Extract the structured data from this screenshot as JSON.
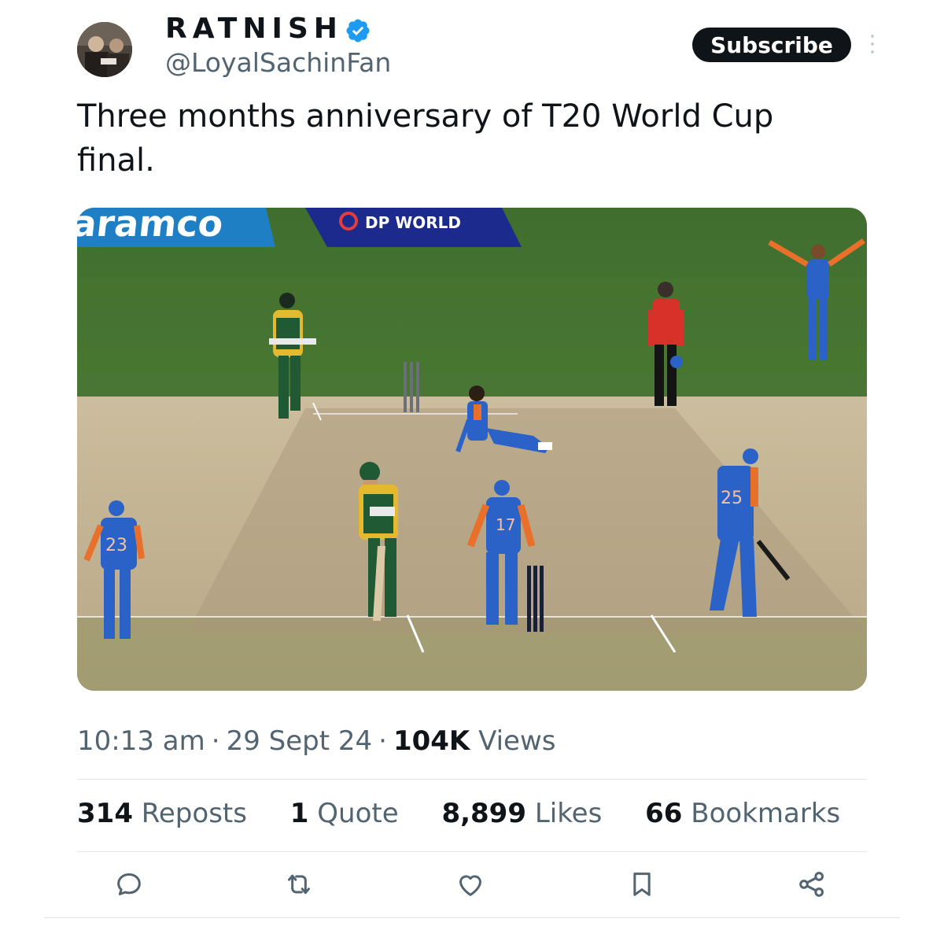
{
  "author": {
    "display_name": "RATNISH",
    "handle": "@LoyalSachinFan",
    "verified_icon": "verified-badge-icon",
    "avatar": "profile-photo"
  },
  "header": {
    "subscribe_label": "Subscribe",
    "more_icon": "more-vertical-icon"
  },
  "tweet": {
    "text": "Three months anniversary of T20 World Cup final.",
    "media": {
      "board_left_text": "aramco",
      "board_right_text": "DP WORLD",
      "jersey_numbers": [
        "23",
        "17",
        "25"
      ]
    },
    "time": "10:13 am",
    "date": "29 Sept 24",
    "views_count": "104K",
    "views_label": "Views"
  },
  "stats": [
    {
      "count": "314",
      "label": "Reposts"
    },
    {
      "count": "1",
      "label": "Quote"
    },
    {
      "count": "8,899",
      "label": "Likes"
    },
    {
      "count": "66",
      "label": "Bookmarks"
    }
  ],
  "actions": [
    "reply-icon",
    "repost-icon",
    "like-icon",
    "bookmark-icon",
    "share-icon"
  ],
  "colors": {
    "verified_blue": "#1d9bf0",
    "text_primary": "#0f1419",
    "text_secondary": "#536471",
    "india_blue": "#2a62c8",
    "india_orange": "#e8702a",
    "sa_green": "#1f5a34",
    "pitch": "#c8b896",
    "outfield": "#4e7a3a"
  }
}
